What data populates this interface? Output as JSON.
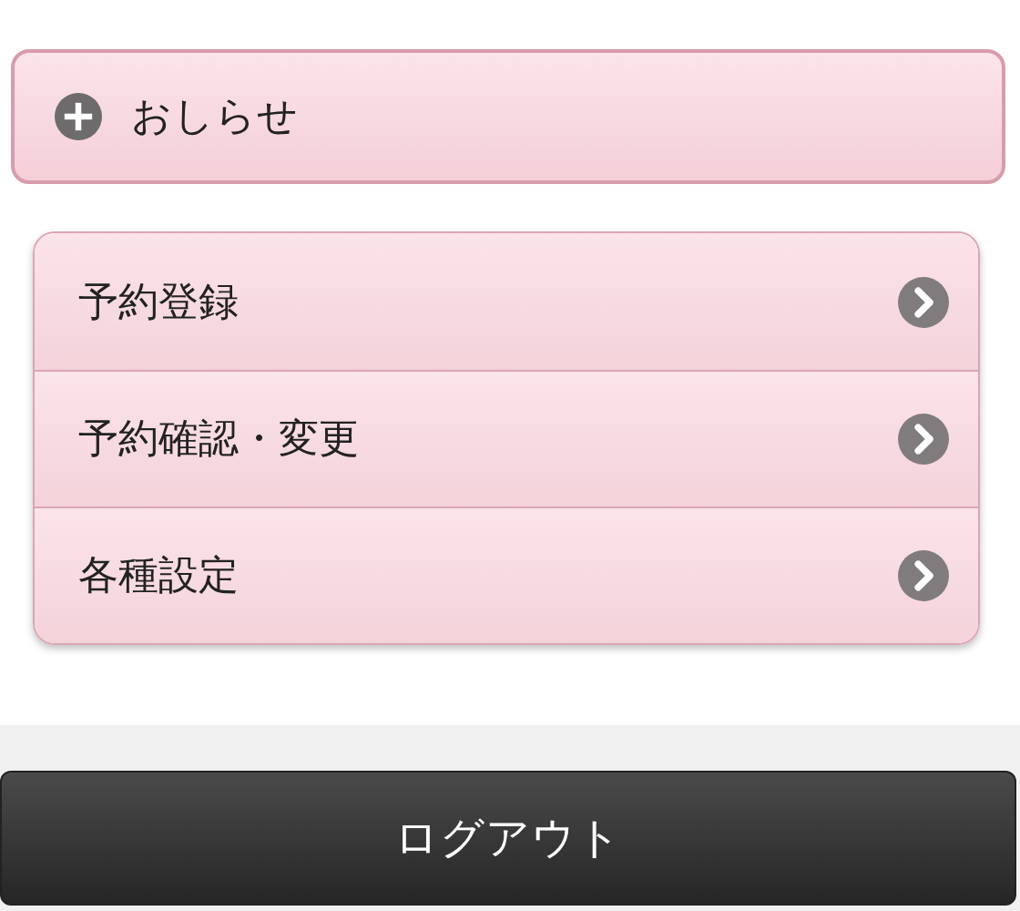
{
  "notice": {
    "label": "おしらせ",
    "expanded": false
  },
  "menu": [
    {
      "label": "予約登録"
    },
    {
      "label": "予約確認・変更"
    },
    {
      "label": "各種設定"
    }
  ],
  "logout": {
    "label": "ログアウト"
  }
}
